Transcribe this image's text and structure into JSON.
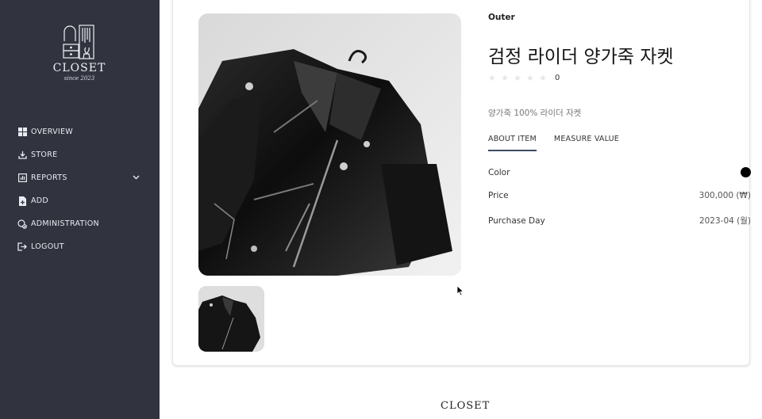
{
  "sidebar": {
    "logo": {
      "name": "CLOSET",
      "since": "since 2023"
    },
    "items": [
      {
        "label": "OVERVIEW",
        "icon": "grid-icon"
      },
      {
        "label": "STORE",
        "icon": "download-icon"
      },
      {
        "label": "REPORTS",
        "icon": "chart-icon",
        "expandable": true
      },
      {
        "label": "ADD",
        "icon": "file-add-icon"
      },
      {
        "label": "ADMINISTRATION",
        "icon": "admin-icon"
      },
      {
        "label": "LOGOUT",
        "icon": "logout-icon"
      }
    ]
  },
  "product": {
    "category": "Outer",
    "title": "검정 라이더 양가죽 자켓",
    "rating": {
      "stars": 0,
      "max": 5,
      "count": "0"
    },
    "description": "양가죽 100% 라이더 자켓",
    "tabs": [
      {
        "label": "ABOUT ITEM",
        "active": true
      },
      {
        "label": "MEASURE VALUE",
        "active": false
      }
    ],
    "details": {
      "color_label": "Color",
      "color_value": "#000000",
      "price_label": "Price",
      "price_value": "300,000 (₩)",
      "purchase_label": "Purchase Day",
      "purchase_value": "2023-04 (월)"
    }
  },
  "footer": {
    "brand": "CLOSET"
  },
  "colors": {
    "sidebar_bg": "#31343f",
    "tab_underline": "#3b4a66"
  }
}
